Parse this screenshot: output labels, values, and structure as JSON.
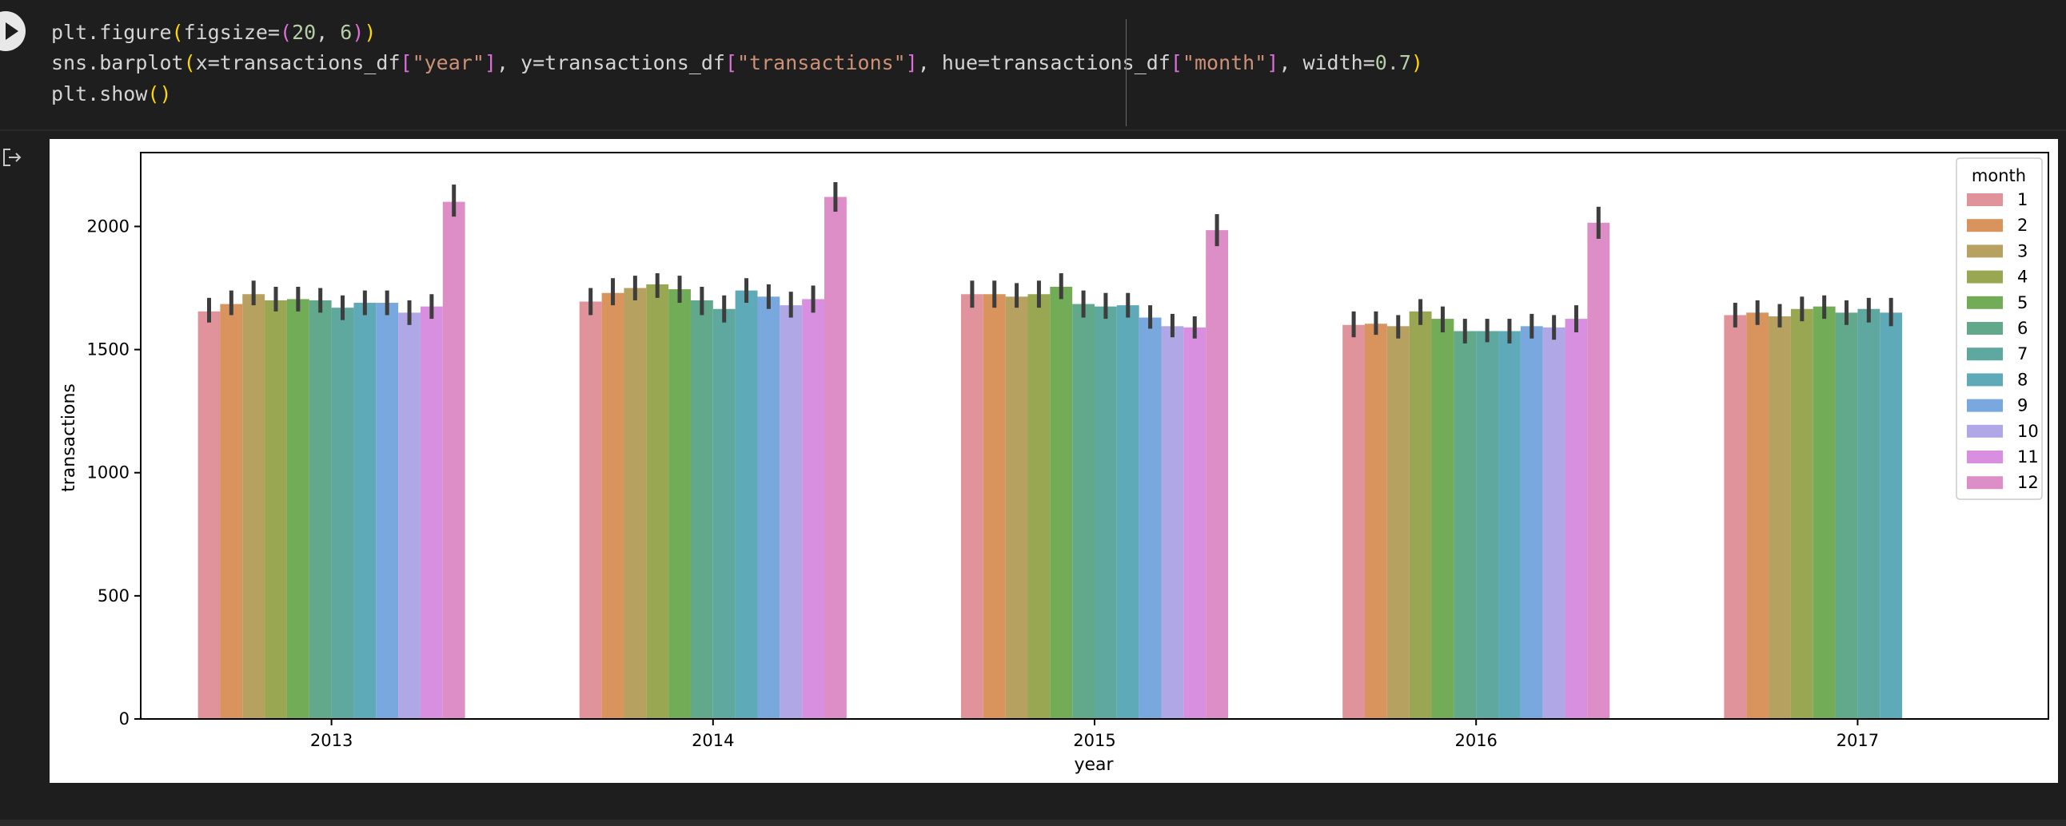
{
  "code": {
    "line1": {
      "p1": "plt.figure",
      "p2": "(",
      "p3": "figsize=",
      "p4": "(",
      "p5": "20",
      "p6": ", ",
      "p7": "6",
      "p8": ")",
      "p9": ")"
    },
    "line2": {
      "p1": "sns.barplot",
      "p2": "(",
      "p3": "x=transactions_df",
      "p4": "[",
      "p5": "\"year\"",
      "p6": "]",
      "p7": ", y=transactions_df",
      "p8": "[",
      "p9": "\"transactions\"",
      "p10": "]",
      "p11": ", hue=transactions_df",
      "p12": "[",
      "p13": "\"month\"",
      "p14": "]",
      "p15": ", width=",
      "p16": "0.7",
      "p17": ")"
    },
    "line3": {
      "p1": "plt.show",
      "p2": "()"
    }
  },
  "icons": {
    "run": "play-icon",
    "output": "output-arrow-icon"
  },
  "chart_data": {
    "type": "bar",
    "categories": [
      "2013",
      "2014",
      "2015",
      "2016",
      "2017"
    ],
    "xlabel": "year",
    "ylabel": "transactions",
    "ylim": [
      0,
      2300
    ],
    "yticks": [
      0,
      500,
      1000,
      1500,
      2000
    ],
    "legend_title": "month",
    "legend_position": "top-right",
    "grid": false,
    "series": [
      {
        "name": "1",
        "color": "#e1939b",
        "values": [
          1655,
          1695,
          1725,
          1600,
          1640
        ]
      },
      {
        "name": "2",
        "color": "#d9935d",
        "values": [
          1685,
          1730,
          1725,
          1605,
          1650
        ]
      },
      {
        "name": "3",
        "color": "#b6a160",
        "values": [
          1725,
          1750,
          1715,
          1595,
          1635
        ]
      },
      {
        "name": "4",
        "color": "#9aa752",
        "values": [
          1700,
          1765,
          1725,
          1655,
          1665
        ]
      },
      {
        "name": "5",
        "color": "#72ac57",
        "values": [
          1705,
          1745,
          1755,
          1625,
          1675
        ]
      },
      {
        "name": "6",
        "color": "#62a98c",
        "values": [
          1700,
          1700,
          1685,
          1575,
          1650
        ]
      },
      {
        "name": "7",
        "color": "#5ea8a0",
        "values": [
          1670,
          1665,
          1675,
          1575,
          1665
        ]
      },
      {
        "name": "8",
        "color": "#5faab8",
        "values": [
          1690,
          1740,
          1680,
          1575,
          1650
        ]
      },
      {
        "name": "9",
        "color": "#79a8df",
        "values": [
          1690,
          1715,
          1630,
          1595,
          null
        ]
      },
      {
        "name": "10",
        "color": "#b0a7e6",
        "values": [
          1650,
          1680,
          1595,
          1590,
          null
        ]
      },
      {
        "name": "11",
        "color": "#d98fe0",
        "values": [
          1675,
          1705,
          1590,
          1625,
          null
        ]
      },
      {
        "name": "12",
        "color": "#dd8ec6",
        "values": [
          2100,
          2120,
          1985,
          2015,
          null
        ]
      }
    ],
    "error_bars": [
      [
        [
          1610,
          1710
        ],
        [
          1640,
          1740
        ],
        [
          1680,
          1780
        ],
        [
          1655,
          1755
        ],
        [
          1655,
          1755
        ],
        [
          1650,
          1750
        ],
        [
          1620,
          1720
        ],
        [
          1640,
          1740
        ],
        [
          1640,
          1740
        ],
        [
          1600,
          1700
        ],
        [
          1625,
          1725
        ],
        [
          2040,
          2170
        ]
      ],
      [
        [
          1640,
          1750
        ],
        [
          1680,
          1790
        ],
        [
          1700,
          1800
        ],
        [
          1710,
          1810
        ],
        [
          1690,
          1800
        ],
        [
          1640,
          1755
        ],
        [
          1610,
          1720
        ],
        [
          1690,
          1790
        ],
        [
          1665,
          1765
        ],
        [
          1630,
          1735
        ],
        [
          1650,
          1760
        ],
        [
          2060,
          2180
        ]
      ],
      [
        [
          1670,
          1780
        ],
        [
          1670,
          1780
        ],
        [
          1670,
          1770
        ],
        [
          1670,
          1780
        ],
        [
          1705,
          1810
        ],
        [
          1630,
          1740
        ],
        [
          1625,
          1730
        ],
        [
          1630,
          1730
        ],
        [
          1585,
          1680
        ],
        [
          1550,
          1645
        ],
        [
          1545,
          1635
        ],
        [
          1920,
          2050
        ]
      ],
      [
        [
          1550,
          1655
        ],
        [
          1560,
          1655
        ],
        [
          1545,
          1640
        ],
        [
          1600,
          1705
        ],
        [
          1570,
          1675
        ],
        [
          1525,
          1625
        ],
        [
          1530,
          1625
        ],
        [
          1525,
          1625
        ],
        [
          1545,
          1645
        ],
        [
          1540,
          1640
        ],
        [
          1570,
          1680
        ],
        [
          1950,
          2080
        ]
      ],
      [
        [
          1590,
          1690
        ],
        [
          1600,
          1700
        ],
        [
          1590,
          1685
        ],
        [
          1615,
          1715
        ],
        [
          1625,
          1720
        ],
        [
          1600,
          1700
        ],
        [
          1610,
          1710
        ],
        [
          1595,
          1710
        ],
        [
          null,
          null
        ],
        [
          null,
          null
        ],
        [
          null,
          null
        ],
        [
          null,
          null
        ]
      ]
    ]
  }
}
